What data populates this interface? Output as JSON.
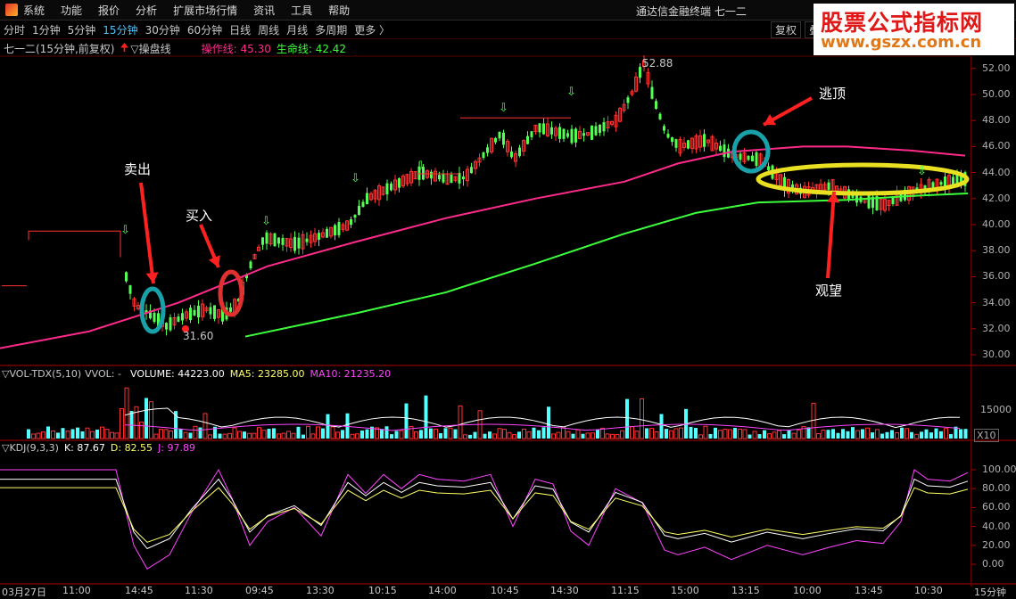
{
  "menu": {
    "items": [
      "系统",
      "功能",
      "报价",
      "分析",
      "扩展市场行情",
      "资讯",
      "工具",
      "帮助"
    ],
    "title": "通达信金融终端  七一二"
  },
  "toolbar": {
    "items": [
      "分时",
      "1分钟",
      "5分钟",
      "15分钟",
      "30分钟",
      "60分钟",
      "日线",
      "周线",
      "月线",
      "多周期",
      "更多 〉"
    ],
    "active": "15分钟",
    "right_items": [
      "复权",
      "叠"
    ]
  },
  "watermark": {
    "line1": "股票公式指标网",
    "line2": "www.gszx.com.cn"
  },
  "main_info": {
    "stock": "七一二(15分钟,前复权)",
    "indicator": "▽操盘线",
    "op_line_label": "操作线: 45.30",
    "life_line_label": "生命线: 42.42"
  },
  "price_axis": {
    "ticks": [
      "52.00",
      "50.00",
      "48.00",
      "46.00",
      "44.00",
      "42.00",
      "40.00",
      "38.00",
      "36.00",
      "34.00",
      "32.00",
      "30.00"
    ]
  },
  "price_marks": {
    "high": "52.88",
    "low": "31.60"
  },
  "annotations": {
    "sell": "卖出",
    "buy": "买入",
    "escape": "逃顶",
    "watch": "观望"
  },
  "vol_info": {
    "title": "▽VOL-TDX(5,10)",
    "vvol": "VVOL: -",
    "volume": "VOLUME: 44223.00",
    "ma5": "MA5: 23285.00",
    "ma10": "MA10: 21235.20"
  },
  "vol_axis": {
    "tick": "15000",
    "unit": "X10"
  },
  "kdj_info": {
    "title": "▽KDJ(9,3,3)",
    "k": "K: 87.67",
    "d": "D: 82.55",
    "j": "J: 97.89"
  },
  "kdj_axis": {
    "ticks": [
      "100.00",
      "80.00",
      "60.00",
      "40.00",
      "20.00",
      "0.00"
    ]
  },
  "time_axis": {
    "labels": [
      "03月27日",
      "11:00",
      "14:45",
      "11:30",
      "09:45",
      "13:30",
      "10:15",
      "14:00",
      "10:45",
      "14:30",
      "11:15",
      "15:00",
      "13:15",
      "10:00",
      "13:45",
      "10:30"
    ],
    "period": "15分钟"
  },
  "colors": {
    "up": "#ff3232",
    "down": "#54ff54",
    "op_line": "#ff2a8a",
    "life_line": "#3cff3c",
    "vol_down": "#54ffff",
    "axis": "#b00000",
    "k": "#ffffff",
    "d": "#ffff66",
    "j": "#ff44ff"
  }
}
